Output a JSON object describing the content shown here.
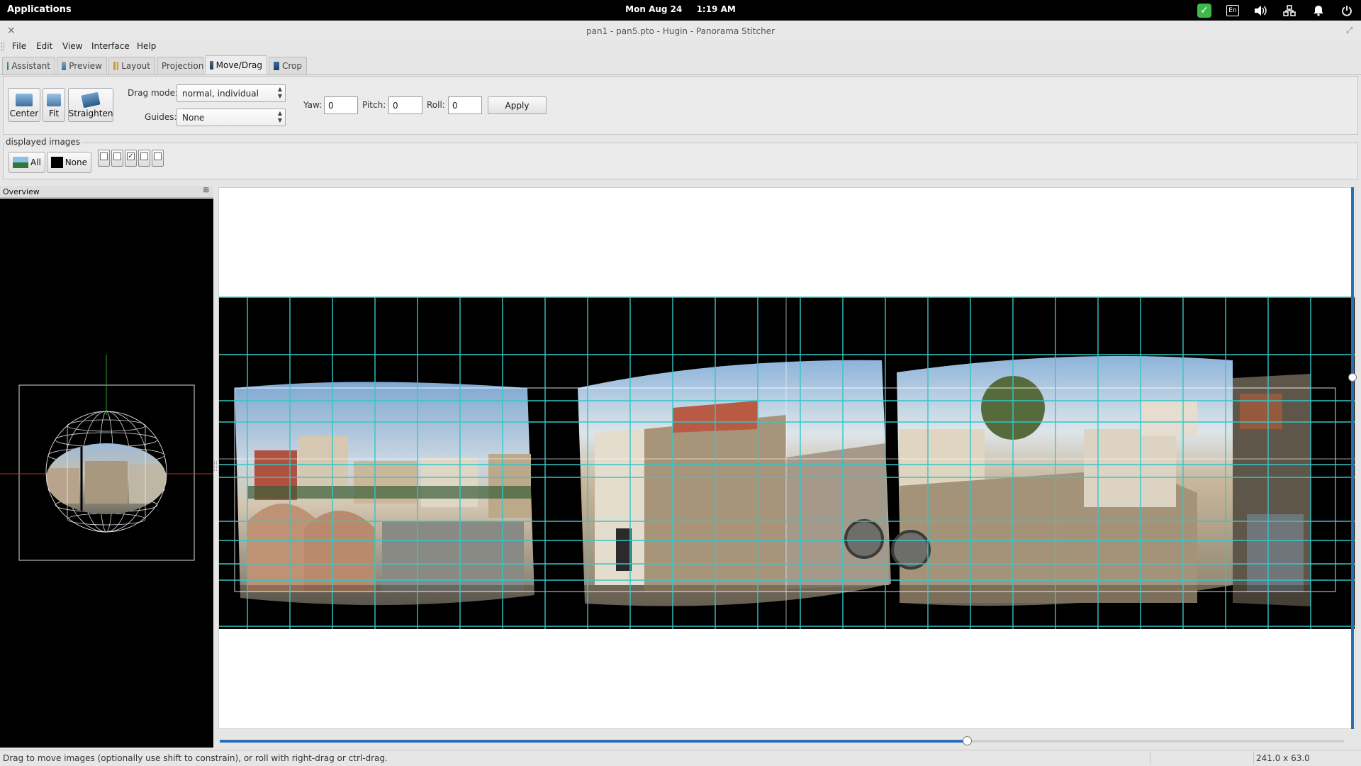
{
  "topbar": {
    "applications": "Applications",
    "date": "Mon Aug 24",
    "time": "1:19 AM",
    "keyboard_layout": "En",
    "tray_icons": [
      "check-shield-icon",
      "keyboard-layout-icon",
      "volume-icon",
      "network-icon",
      "notification-bell-icon",
      "power-icon"
    ]
  },
  "window": {
    "title": "pan1 - pan5.pto - Hugin - Panorama Stitcher"
  },
  "menu": [
    "File",
    "Edit",
    "View",
    "Interface",
    "Help"
  ],
  "tabs": [
    {
      "label": "Assistant",
      "icon": "assistant-icon"
    },
    {
      "label": "Preview",
      "icon": "preview-icon"
    },
    {
      "label": "Layout",
      "icon": "layout-icon"
    },
    {
      "label": "Projection",
      "icon": ""
    },
    {
      "label": "Move/Drag",
      "icon": "move-drag-icon",
      "active": true
    },
    {
      "label": "Crop",
      "icon": "crop-icon"
    }
  ],
  "toolbar": {
    "center_label": "Center",
    "fit_label": "Fit",
    "straighten_label": "Straighten",
    "drag_mode_label": "Drag mode:",
    "drag_mode_value": "normal, individual",
    "guides_label": "Guides:",
    "guides_value": "None",
    "yaw_label": "Yaw:",
    "yaw_value": "0",
    "pitch_label": "Pitch:",
    "pitch_value": "0",
    "roll_label": "Roll:",
    "roll_value": "0",
    "apply_label": "Apply"
  },
  "displayed_images": {
    "legend": "displayed images",
    "all_label": "All",
    "none_label": "None",
    "images": [
      false,
      false,
      true,
      false,
      false
    ]
  },
  "overview": {
    "title": "Overview"
  },
  "status": {
    "message": "Drag to move images (optionally use shift to constrain), or roll with right-drag or ctrl-drag.",
    "dimensions": "241.0 x 63.0"
  },
  "colors": {
    "grid": "#36c6c6",
    "accent": "#2a6fb5"
  }
}
